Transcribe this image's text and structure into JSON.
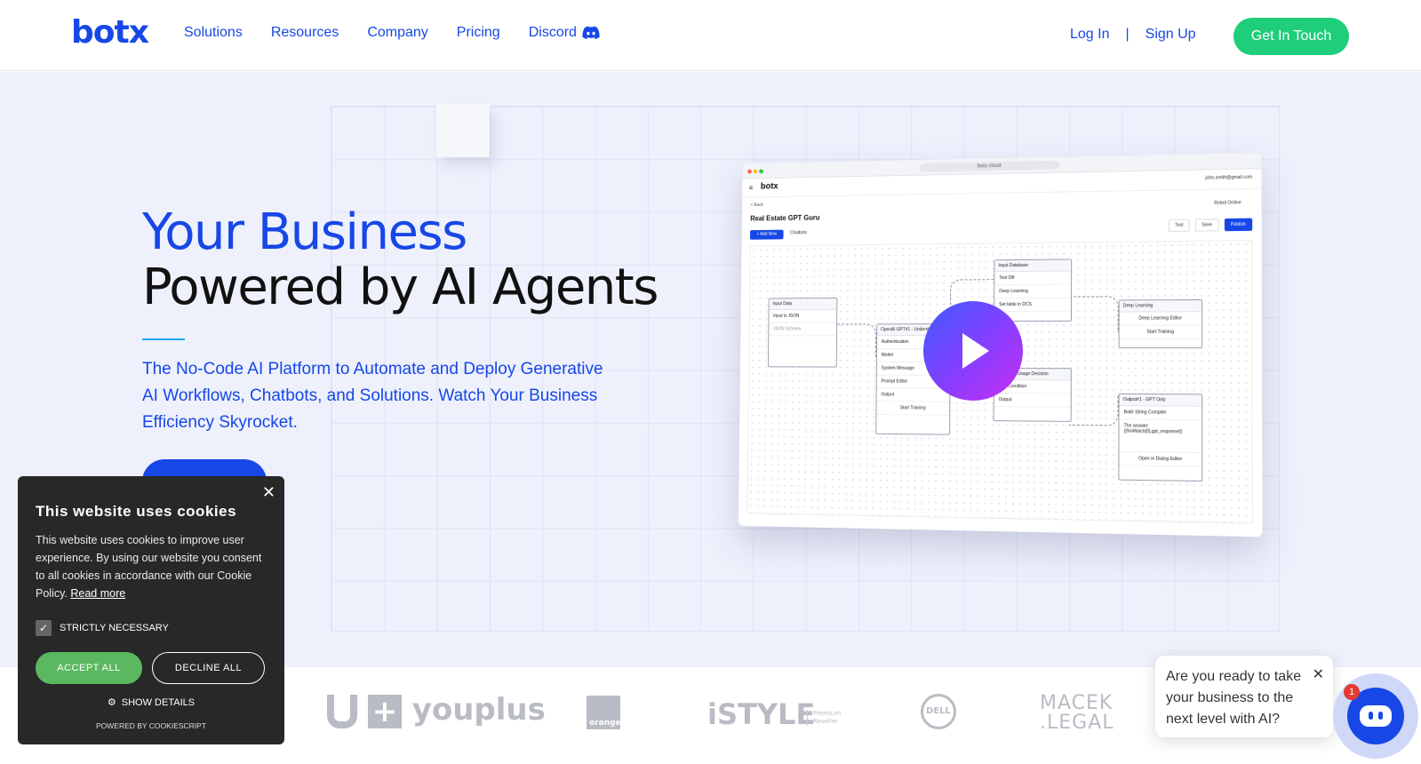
{
  "header": {
    "logo": "botx",
    "nav": [
      "Solutions",
      "Resources",
      "Company",
      "Pricing",
      "Discord"
    ],
    "login": "Log In",
    "separator": "|",
    "signup": "Sign Up",
    "cta": "Get In Touch"
  },
  "hero": {
    "headline_1": "Your Business",
    "headline_2": "Powered by AI Agents",
    "subtitle": "The No-Code AI Platform to Automate and Deploy Generative AI Workflows, Chatbots, and Solutions. Watch Your Business Efficiency Skyrocket."
  },
  "mockup": {
    "url": "botx.cloud",
    "logo": "botx",
    "user": "john.smith@gmail.com",
    "back": "< Back",
    "title": "Real Estate GPT Guru",
    "robot_online": "Robot Online",
    "add_new": "+ Add New",
    "chatbots": "Chatbots",
    "test": "Test",
    "save": "Save",
    "publish": "Publish",
    "nodes": {
      "input_data": {
        "title": "Input Data",
        "rows": [
          "Input is JSON",
          "JSON Schema"
        ]
      },
      "openai": {
        "title": "OpenAI GPT#1 - Understand",
        "rows": [
          "Authentication",
          "Model",
          "System Message",
          "Prompt Editor",
          "Output",
          "Start Training"
        ]
      },
      "input_db": {
        "title": "Input Database",
        "rows": [
          "Test DB",
          "Deep Learning",
          "Set table in DCS"
        ]
      },
      "tool_usage": {
        "title": "GPT Tool Usage Decision",
        "rows": [
          "Tool Condition",
          "Output"
        ]
      },
      "deep_learning": {
        "title": "Deep Learning",
        "rows": [
          "Deep Learning Editor",
          "Start Training"
        ]
      },
      "output": {
        "title": "Output#1 - GPT Only",
        "rows": [
          "BotX String Compiler",
          "The answer: {{NoMatch[0].gpt_response}}",
          "Open in Dialog Editor"
        ]
      }
    }
  },
  "logos": [
    "youplus",
    "orange",
    "iSTYLE",
    "Premium Reseller",
    "DELL",
    "MACEK .LEGAL"
  ],
  "cookie": {
    "title": "This website uses cookies",
    "text": "This website uses cookies to improve user experience. By using our website you consent to all cookies in accordance with our Cookie Policy.",
    "read_more": "Read more",
    "strictly_necessary": "STRICTLY NECESSARY",
    "accept": "ACCEPT ALL",
    "decline": "DECLINE ALL",
    "show_details": "SHOW DETAILS",
    "powered": "POWERED BY COOKIESCRIPT"
  },
  "chat": {
    "message": "Are you ready to take your business to the next level with AI?",
    "badge": "1"
  },
  "colors": {
    "brand": "#1747e6",
    "green": "#1fce7a",
    "hero_bg": "#eef1fc"
  }
}
